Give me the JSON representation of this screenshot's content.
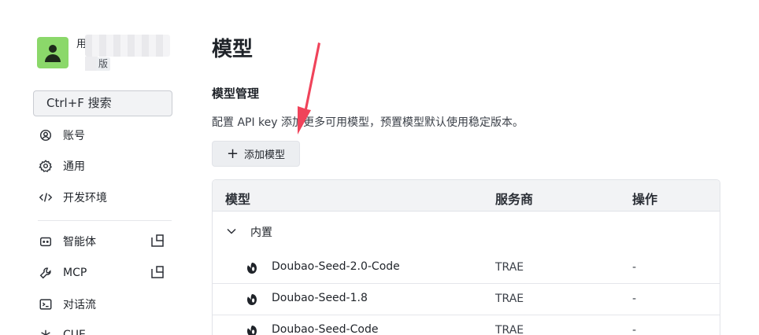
{
  "sidebar": {
    "user": {
      "name_prefix": "用户",
      "plan_suffix": "版"
    },
    "search_placeholder": "Ctrl+F 搜索",
    "items": [
      {
        "label": "账号",
        "icon": "account-icon"
      },
      {
        "label": "通用",
        "icon": "gear-icon"
      },
      {
        "label": "开发环境",
        "icon": "code-icon"
      },
      {
        "label": "智能体",
        "icon": "agent-icon"
      },
      {
        "label": "MCP",
        "icon": "wrench-icon"
      },
      {
        "label": "对话流",
        "icon": "terminal-icon"
      },
      {
        "label": "CUE",
        "icon": "asterisk-icon"
      }
    ]
  },
  "main": {
    "title": "模型",
    "section_title": "模型管理",
    "section_desc": "配置 API key 添加更多可用模型，预置模型默认使用稳定版本。",
    "add_button": "添加模型",
    "table": {
      "headers": {
        "model": "模型",
        "vendor": "服务商",
        "action": "操作"
      },
      "group_label": "内置",
      "rows": [
        {
          "name": "Doubao-Seed-2.0-Code",
          "vendor": "TRAE",
          "action": "-"
        },
        {
          "name": "Doubao-Seed-1.8",
          "vendor": "TRAE",
          "action": "-"
        },
        {
          "name": "Doubao-Seed-Code",
          "vendor": "TRAE",
          "action": "-"
        }
      ]
    }
  },
  "colors": {
    "avatar_bg": "#8bd86a",
    "annotation_arrow": "#f0435a"
  }
}
